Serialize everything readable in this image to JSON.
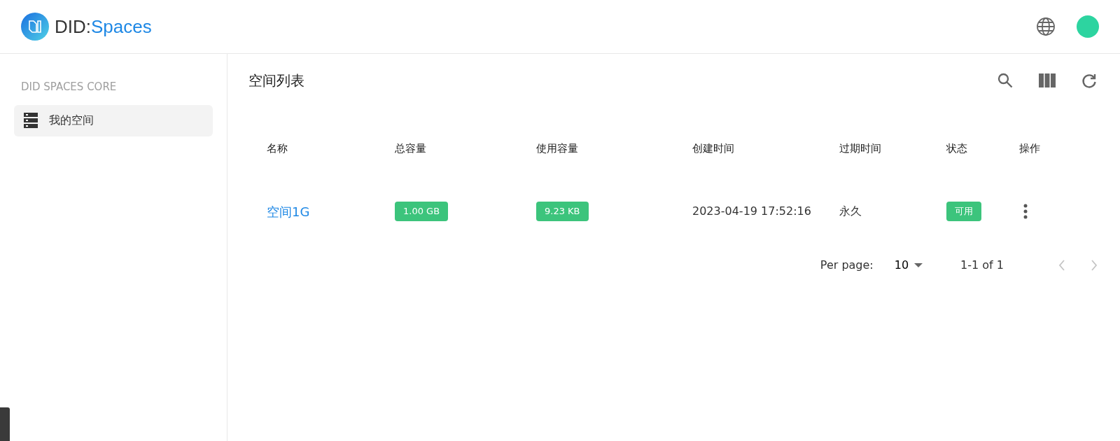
{
  "header": {
    "brand": {
      "prefix": "DID:",
      "suffix": "Spaces"
    }
  },
  "sidebar": {
    "section": "DID SPACES CORE",
    "items": [
      {
        "label": "我的空间",
        "selected": true
      }
    ]
  },
  "main": {
    "title": "空间列表",
    "table": {
      "columns": [
        "名称",
        "总容量",
        "使用容量",
        "创建时间",
        "过期时间",
        "状态",
        "操作"
      ],
      "rows": [
        {
          "name": "空间1G",
          "total": "1.00 GB",
          "used": "9.23 KB",
          "created": "2023-04-19 17:52:16",
          "expires": "永久",
          "status": "可用"
        }
      ]
    },
    "pagination": {
      "per_page_label": "Per page:",
      "per_page": "10",
      "range": "1-1 of 1",
      "prev_disabled": true,
      "next_disabled": true
    }
  }
}
